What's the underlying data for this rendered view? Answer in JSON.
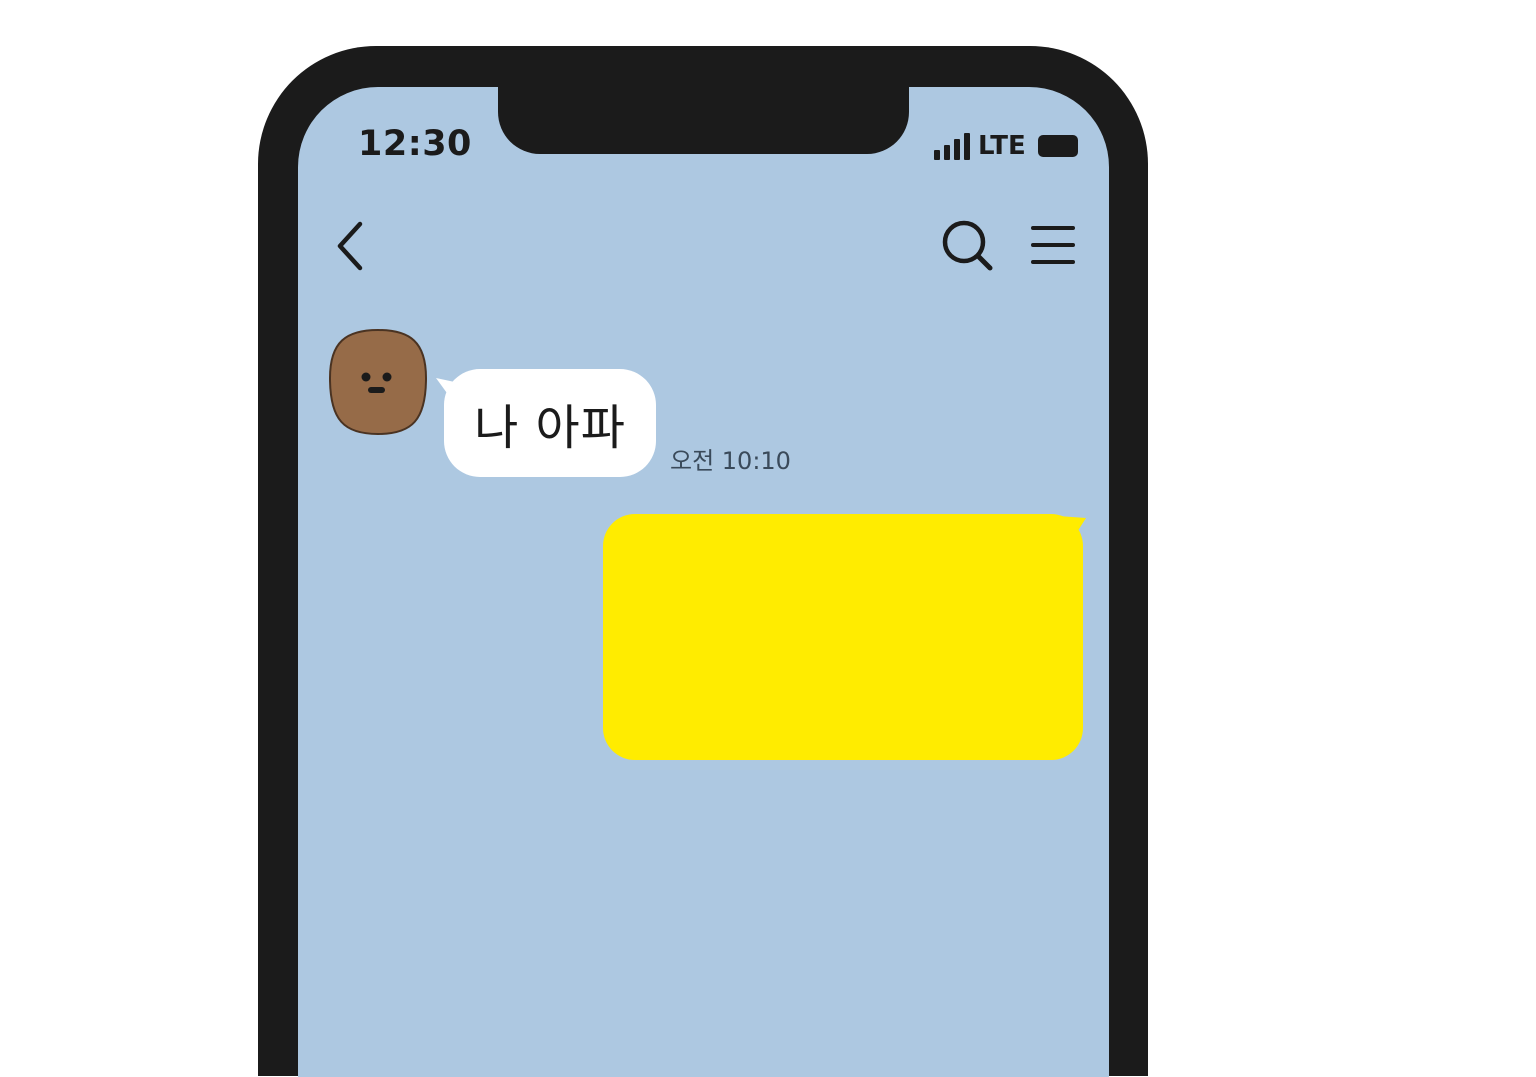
{
  "status_bar": {
    "time": "12:30",
    "network": "LTE"
  },
  "header": {
    "back_icon": "chevron-left-icon",
    "search_icon": "search-icon",
    "menu_icon": "hamburger-menu-icon"
  },
  "messages": [
    {
      "direction": "incoming",
      "text": "나 아파",
      "time": "오전 10:10",
      "avatar_icon": "brown-face-avatar"
    },
    {
      "direction": "outgoing",
      "text": ""
    }
  ],
  "colors": {
    "chat_background": "#adc8e1",
    "outgoing_bubble": "#ffec00",
    "incoming_bubble": "#ffffff",
    "avatar": "#966b48",
    "frame": "#1b1b1b"
  }
}
